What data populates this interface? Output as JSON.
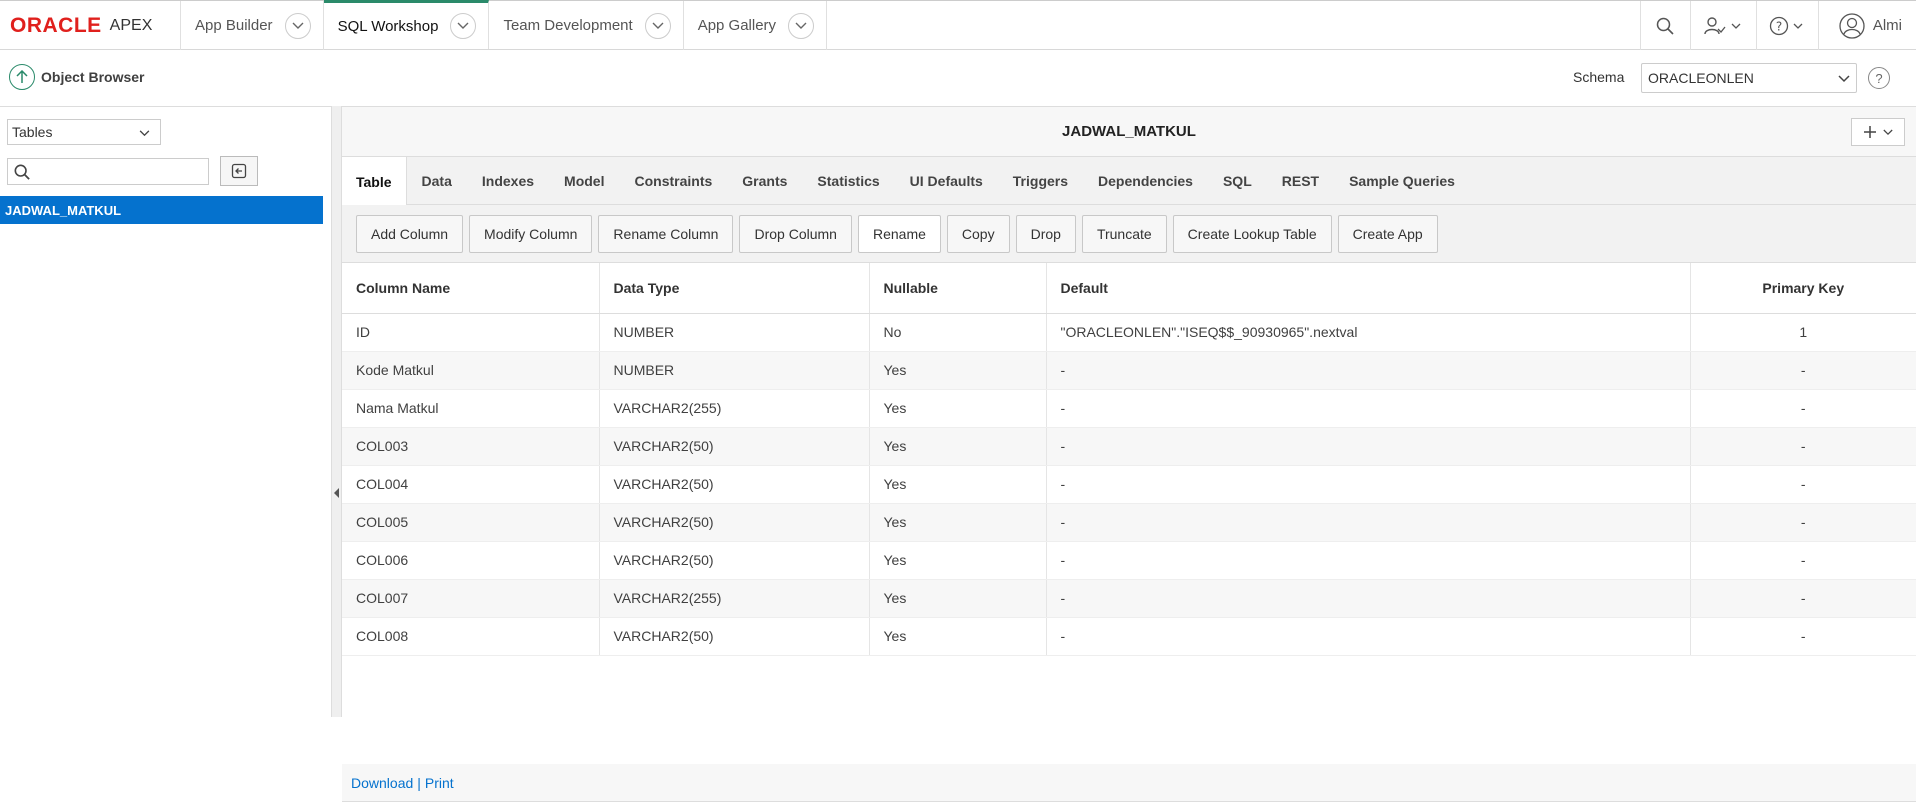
{
  "brand": {
    "oracle": "ORACLE",
    "apex": "APEX"
  },
  "nav": {
    "tabs": [
      {
        "label": "App Builder"
      },
      {
        "label": "SQL Workshop"
      },
      {
        "label": "Team Development"
      },
      {
        "label": "App Gallery"
      }
    ],
    "user": "Almi"
  },
  "header": {
    "title": "Object Browser",
    "schema_label": "Schema",
    "schema_value": "ORACLEONLEN",
    "help": "?"
  },
  "sidebar": {
    "object_type": "Tables",
    "search_value": "",
    "items": [
      {
        "label": "JADWAL_MATKUL"
      }
    ]
  },
  "main": {
    "title": "JADWAL_MATKUL",
    "tabs": [
      "Table",
      "Data",
      "Indexes",
      "Model",
      "Constraints",
      "Grants",
      "Statistics",
      "UI Defaults",
      "Triggers",
      "Dependencies",
      "SQL",
      "REST",
      "Sample Queries"
    ],
    "buttons": [
      "Add Column",
      "Modify Column",
      "Rename Column",
      "Drop Column",
      "Rename",
      "Copy",
      "Drop",
      "Truncate",
      "Create Lookup Table",
      "Create App"
    ],
    "columns": [
      "Column Name",
      "Data Type",
      "Nullable",
      "Default",
      "Primary Key"
    ],
    "rows": [
      [
        "ID",
        "NUMBER",
        "No",
        "\"ORACLEONLEN\".\"ISEQ$$_90930965\".nextval",
        "1"
      ],
      [
        "Kode Matkul",
        "NUMBER",
        "Yes",
        "-",
        "-"
      ],
      [
        "Nama Matkul",
        "VARCHAR2(255)",
        "Yes",
        "-",
        "-"
      ],
      [
        "COL003",
        "VARCHAR2(50)",
        "Yes",
        "-",
        "-"
      ],
      [
        "COL004",
        "VARCHAR2(50)",
        "Yes",
        "-",
        "-"
      ],
      [
        "COL005",
        "VARCHAR2(50)",
        "Yes",
        "-",
        "-"
      ],
      [
        "COL006",
        "VARCHAR2(50)",
        "Yes",
        "-",
        "-"
      ],
      [
        "COL007",
        "VARCHAR2(255)",
        "Yes",
        "-",
        "-"
      ],
      [
        "COL008",
        "VARCHAR2(50)",
        "Yes",
        "-",
        "-"
      ]
    ],
    "footer": {
      "download": "Download",
      "separator": "|",
      "print": "Print"
    }
  },
  "colors": {
    "accent": "#2a8a6a",
    "selected": "#0572ce",
    "oracle_red": "#e0201d"
  }
}
